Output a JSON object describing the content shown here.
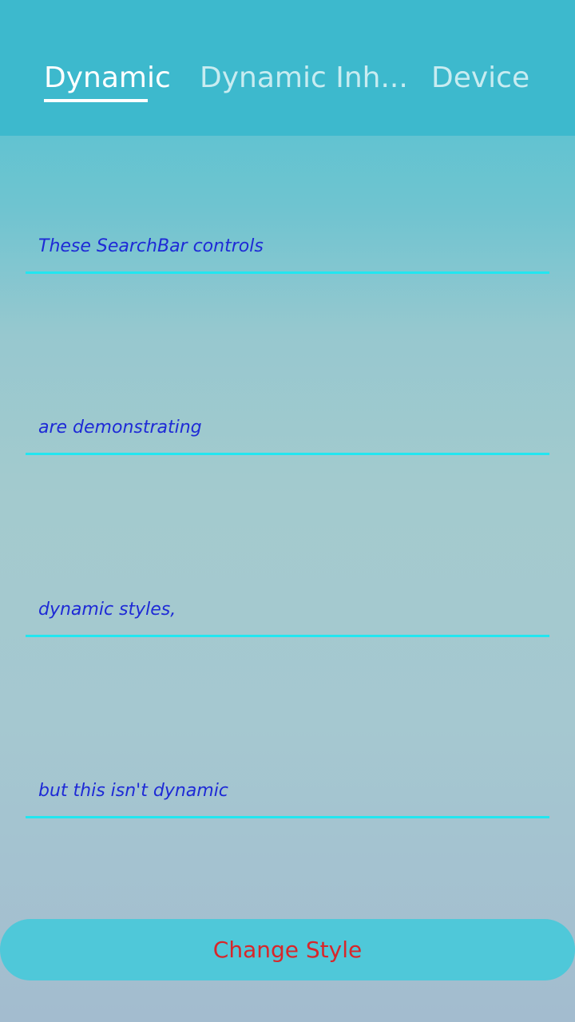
{
  "tabs": [
    {
      "label": "Dynamic",
      "active": true
    },
    {
      "label": "Dynamic Inh...",
      "active": false
    },
    {
      "label": "Device",
      "active": false
    }
  ],
  "searchbars": [
    {
      "placeholder": "These SearchBar controls"
    },
    {
      "placeholder": "are demonstrating"
    },
    {
      "placeholder": "dynamic styles,"
    },
    {
      "placeholder": "but this isn't dynamic"
    }
  ],
  "button": {
    "label": "Change Style"
  },
  "colors": {
    "tabbar_bg": "#3db9cd",
    "searchbar_text": "#1e2ad6",
    "searchbar_underline": "#22e6f0",
    "button_bg": "#4fc8d9",
    "button_text": "#d8262a"
  }
}
